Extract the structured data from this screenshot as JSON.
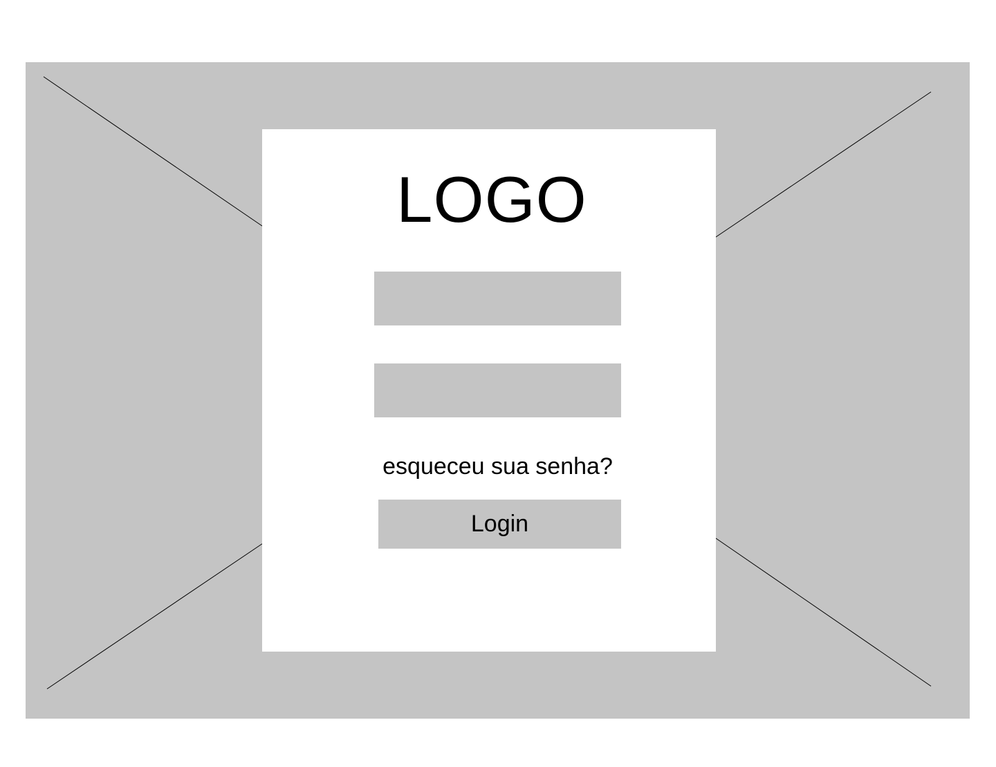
{
  "colors": {
    "background": "#ffffff",
    "placeholder_gray": "#c4c4c4",
    "text": "#000000"
  },
  "login_card": {
    "logo_text": "LOGO",
    "username_field": {
      "value": "",
      "placeholder": ""
    },
    "password_field": {
      "value": "",
      "placeholder": ""
    },
    "forgot_password_link": "esqueceu sua senha?",
    "login_button": "Login"
  }
}
